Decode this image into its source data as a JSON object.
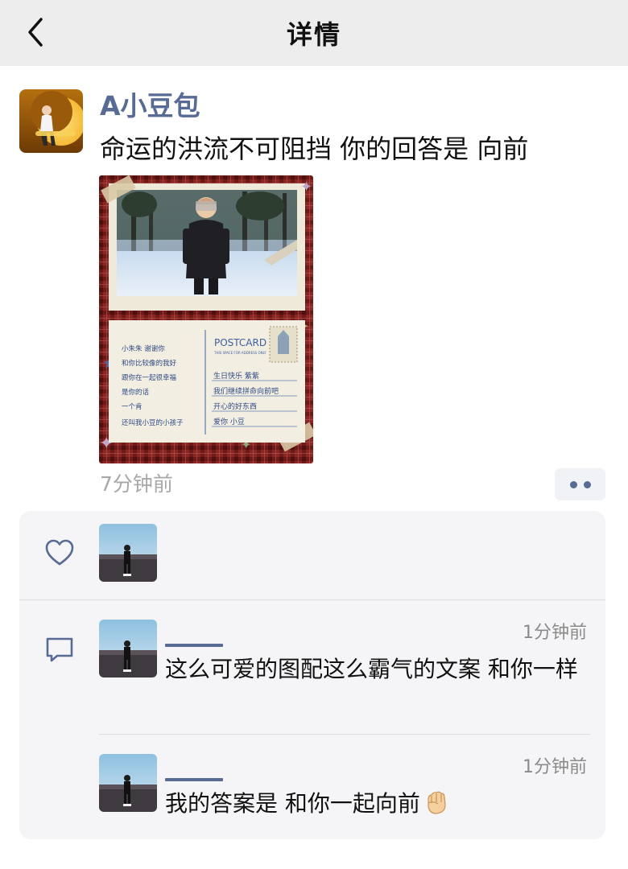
{
  "header": {
    "title": "详情",
    "back_icon": "chevron-left-icon"
  },
  "post": {
    "username": "A小豆包",
    "text": "命运的洪流不可阻挡 你的回答是 向前",
    "time": "7分钟前",
    "more_icon": "more-dots-icon",
    "image": {
      "stamp_label": "POSTCARD",
      "stamp_sub": "THIS SPACE FOR ADDRESS ONLY",
      "left_lines": [
        "小朱朱 谢谢你",
        "和你比较像的我好",
        "跟你在一起很幸福",
        "是你的话",
        "一个肯",
        "还叫我小豆的小孩子"
      ],
      "right_lines": [
        "生日快乐 紫紫",
        "我们继续拼命向前吧",
        "开心的好东西",
        "爱你 小豆"
      ]
    }
  },
  "likes": {
    "icon": "heart-outline-icon",
    "count_avatars": 1
  },
  "comments": {
    "icon": "comment-outline-icon",
    "items": [
      {
        "time": "1分钟前",
        "text": "这么可爱的图配这么霸气的文案 和你一样"
      },
      {
        "time": "1分钟前",
        "text": "我的答案是 和你一起向前",
        "emoji": "raised-fist-emoji"
      }
    ]
  },
  "colors": {
    "link": "#576b95",
    "header_bg": "#ededed",
    "interaction_bg": "#f5f5f7",
    "time_gray": "#a8a8a8"
  }
}
